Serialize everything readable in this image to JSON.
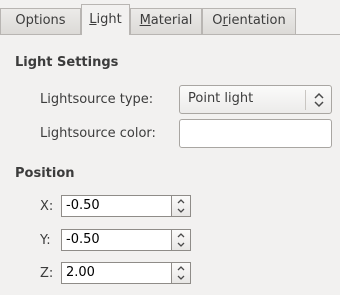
{
  "tabs": [
    {
      "pre": "Options",
      "mnemonic": "",
      "post": "",
      "active": false
    },
    {
      "pre": "",
      "mnemonic": "L",
      "post": "ight",
      "active": true
    },
    {
      "pre": "",
      "mnemonic": "M",
      "post": "aterial",
      "active": false
    },
    {
      "pre": "O",
      "mnemonic": "r",
      "post": "ientation",
      "active": false
    }
  ],
  "light_settings": {
    "title": "Light Settings",
    "type_label": "Lightsource type:",
    "type_value": "Point light",
    "color_label": "Lightsource color:",
    "color_value": "#ffffff"
  },
  "position": {
    "title": "Position",
    "x_label": "X:",
    "x_value": "-0.50",
    "y_label": "Y:",
    "y_value": "-0.50",
    "z_label": "Z:",
    "z_value": "2.00"
  }
}
